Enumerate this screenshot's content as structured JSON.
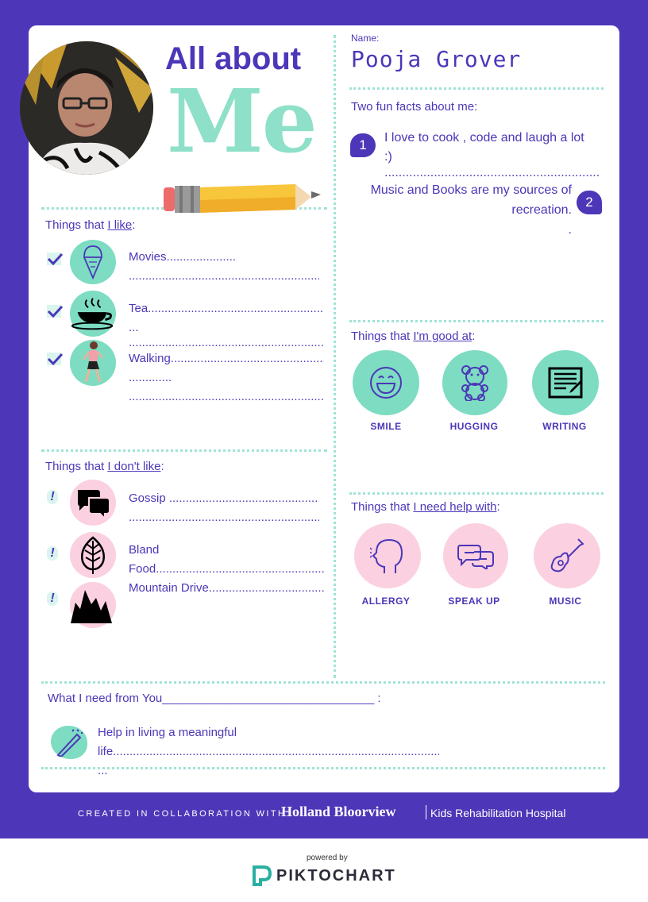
{
  "header": {
    "title_line1": "All about",
    "title_line2": "Me",
    "name_label": "Name:",
    "name_value": "Pooja Grover"
  },
  "facts": {
    "heading": "Two fun facts about me:",
    "items": [
      {
        "number": "1",
        "line1": "I love to cook , code and laugh a lot",
        "line2": ":)",
        "line3": "......................................................................."
      },
      {
        "number": "2",
        "line1": "Music and Books are my sources of",
        "line2": "recreation.",
        "line3": "."
      }
    ]
  },
  "likes": {
    "heading_prefix": "Things that ",
    "heading_link": "I like",
    "heading_suffix": ":",
    "items": [
      {
        "icon": "ice-cream-icon",
        "lines": [
          "Movies.....................",
          "..........................................................."
        ]
      },
      {
        "icon": "tea-cup-icon",
        "lines": [
          "Tea.............................................................",
          "...",
          "..........................................................."
        ]
      },
      {
        "icon": "walking-person-icon",
        "lines": [
          "Walking......................................................",
          ".............",
          "..........................................................."
        ]
      }
    ]
  },
  "dislikes": {
    "heading_prefix": "Things that ",
    "heading_link": "I don't like",
    "heading_suffix": ":",
    "items": [
      {
        "icon": "chat-bubbles-icon",
        "lines": [
          "Gossip ...................................................",
          "..........................................................."
        ]
      },
      {
        "icon": "leaf-icon",
        "lines": [
          "Bland",
          "Food............................................................"
        ]
      },
      {
        "icon": "mountains-icon",
        "lines": [
          "Mountain Drive....................................."
        ]
      }
    ]
  },
  "good_at": {
    "heading_prefix": "Things that ",
    "heading_link": "I'm good at",
    "heading_suffix": ":",
    "items": [
      {
        "icon": "smile-icon",
        "label": "SMILE"
      },
      {
        "icon": "teddy-bear-icon",
        "label": "HUGGING"
      },
      {
        "icon": "writing-icon",
        "label": "WRITING"
      }
    ]
  },
  "help_with": {
    "heading_prefix": "Things that ",
    "heading_link": "I need help with",
    "heading_suffix": ":",
    "items": [
      {
        "icon": "head-sneeze-icon",
        "label": "ALLERGY"
      },
      {
        "icon": "speech-bubbles-icon",
        "label": "SPEAK UP"
      },
      {
        "icon": "guitar-icon",
        "label": "MUSIC"
      }
    ]
  },
  "need": {
    "heading": "What I need from You________________________________ :",
    "line1": "Help in living a meaningful",
    "line2": "life................................................................................................................",
    "line3": "..."
  },
  "footer": {
    "created_label": "CREATED IN COLLABORATION WITH:",
    "org_name": "Holland Bloorview",
    "org_sub": "Kids Rehabilitation Hospital",
    "powered_by": "powered by",
    "brand": "PIKTOCHART"
  },
  "colors": {
    "brand_purple": "#4e36b8",
    "teal": "#7ddcc2",
    "pink": "#fbd0e0",
    "dots": "#9fe3d6"
  }
}
